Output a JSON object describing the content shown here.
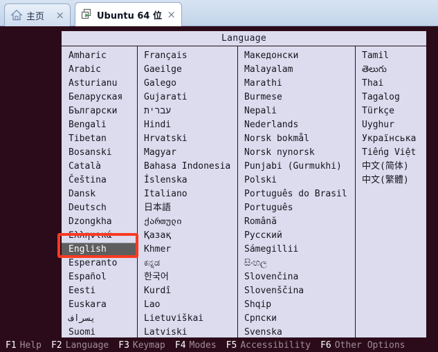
{
  "browser": {
    "tabs": [
      {
        "label": "主页",
        "icon": "home-icon",
        "close": "×",
        "active": false
      },
      {
        "label": "Ubuntu 64 位",
        "icon": "vm-icon",
        "close": "×",
        "active": true
      }
    ]
  },
  "dialog": {
    "title": "Language",
    "selected_language": "English",
    "columns": [
      {
        "items": [
          "Amharic",
          "Arabic",
          "Asturianu",
          "Беларуская",
          "Български",
          "Bengali",
          "Tibetan",
          "Bosanski",
          "Català",
          "Čeština",
          "Dansk",
          "Deutsch",
          "Dzongkha",
          "Ελληνικά",
          "English",
          "Esperanto",
          "Español",
          "Eesti",
          "Euskara",
          "یسراف",
          "Suomi"
        ]
      },
      {
        "items": [
          "Français",
          "Gaeilge",
          "Galego",
          "Gujarati",
          "עברית",
          "Hindi",
          "Hrvatski",
          "Magyar",
          "Bahasa Indonesia",
          "Íslenska",
          "Italiano",
          "日本語",
          "ქართული",
          "Қазақ",
          "Khmer",
          "ಕನ್ನಡ",
          "한국어",
          "Kurdî",
          "Lao",
          "Lietuviškai",
          "Latviski"
        ]
      },
      {
        "items": [
          "Македонски",
          "Malayalam",
          "Marathi",
          "Burmese",
          "Nepali",
          "Nederlands",
          "Norsk bokmål",
          "Norsk nynorsk",
          "Punjabi (Gurmukhi)",
          "Polski",
          "Português do Brasil",
          "Português",
          "Română",
          "Русский",
          "Sámegillii",
          "සිංහල",
          "Slovenčina",
          "Slovenščina",
          "Shqip",
          "Српски",
          "Svenska"
        ]
      },
      {
        "items": [
          "Tamil",
          "తెలుగు",
          "Thai",
          "Tagalog",
          "Türkçe",
          "Uyghur",
          "Українська",
          "Tiếng Việt",
          "中文(简体)",
          "中文(繁體)"
        ]
      }
    ]
  },
  "fkeys": [
    {
      "key": "F1",
      "text": "Help"
    },
    {
      "key": "F2",
      "text": "Language"
    },
    {
      "key": "F3",
      "text": "Keymap"
    },
    {
      "key": "F4",
      "text": "Modes"
    },
    {
      "key": "F5",
      "text": "Accessibility"
    },
    {
      "key": "F6",
      "text": "Other Options"
    }
  ],
  "colors": {
    "background": "#2b0b19",
    "dialog_bg": "#dcdcee",
    "selection_bg": "#5e5e5e",
    "annotation": "#f93a21"
  }
}
